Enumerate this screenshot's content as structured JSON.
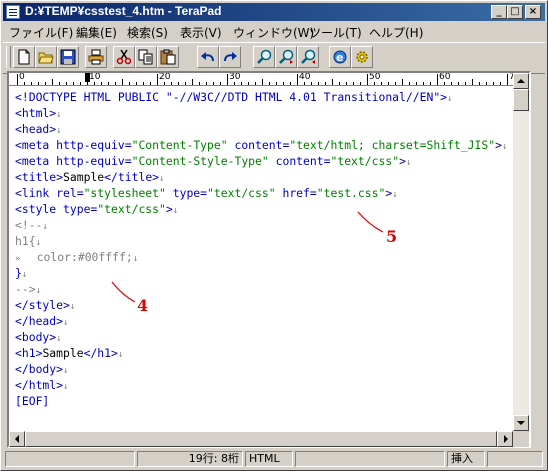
{
  "window": {
    "title": "D:¥TEMP¥csstest_4.htm - TeraPad",
    "controls": {
      "minimize": "_",
      "maximize": "□",
      "close": "×"
    }
  },
  "menu": {
    "items": [
      "ファイル(F)",
      "編集(E)",
      "検索(S)",
      "表示(V)",
      "ウィンドウ(W)",
      "ツール(T)",
      "ヘルプ(H)"
    ]
  },
  "toolbar": {
    "buttons": [
      "new-file-icon",
      "open-folder-icon",
      "save-icon",
      "print-icon",
      "cut-icon",
      "copy-icon",
      "paste-icon",
      "undo-icon",
      "redo-icon",
      "find-icon",
      "find-next-icon",
      "find-prev-icon",
      "browser-icon",
      "settings-icon"
    ]
  },
  "ruler": {
    "labels": [
      "0",
      "10",
      "20",
      "30",
      "40",
      "50",
      "60",
      "70"
    ],
    "caret_column": 10
  },
  "editor": {
    "lines": [
      [
        [
          "<!DOCTYPE HTML PUBLIC \"-//W3C//DTD HTML 4.01 Transitional//EN\">",
          "tag"
        ],
        [
          "↓",
          "mark"
        ]
      ],
      [
        [
          "<html>",
          "tag"
        ],
        [
          "↓",
          "mark"
        ]
      ],
      [
        [
          "<head>",
          "tag"
        ],
        [
          "↓",
          "mark"
        ]
      ],
      [
        [
          "<meta http-equiv=",
          "tag"
        ],
        [
          "\"Content-Type\"",
          "str"
        ],
        [
          " content=",
          "tag"
        ],
        [
          "\"text/html; charset=Shift_JIS\"",
          "str"
        ],
        [
          ">",
          "tag"
        ],
        [
          "↓",
          "mark"
        ]
      ],
      [
        [
          "<meta http-equiv=",
          "tag"
        ],
        [
          "\"Content-Style-Type\"",
          "str"
        ],
        [
          " content=",
          "tag"
        ],
        [
          "\"text/css\"",
          "str"
        ],
        [
          ">",
          "tag"
        ],
        [
          "↓",
          "mark"
        ]
      ],
      [
        [
          "<title>",
          "tag"
        ],
        [
          "Sample",
          "text"
        ],
        [
          "</title>",
          "tag"
        ],
        [
          "↓",
          "mark"
        ]
      ],
      [
        [
          "<link rel=",
          "tag"
        ],
        [
          "\"stylesheet\"",
          "str"
        ],
        [
          " type=",
          "tag"
        ],
        [
          "\"text/css\"",
          "str"
        ],
        [
          " href=",
          "tag"
        ],
        [
          "\"test.css\"",
          "str"
        ],
        [
          ">",
          "tag"
        ],
        [
          "↓",
          "mark"
        ]
      ],
      [
        [
          "<style type=",
          "tag"
        ],
        [
          "\"text/css\"",
          "str"
        ],
        [
          ">",
          "tag"
        ],
        [
          "↓",
          "mark"
        ]
      ],
      [
        [
          "<!--",
          "css"
        ],
        [
          "↓",
          "mark"
        ]
      ],
      [
        [
          "h1{",
          "css"
        ],
        [
          "↓",
          "mark"
        ]
      ],
      [
        [
          "»   ",
          "mark"
        ],
        [
          "color:#00ffff;",
          "css"
        ],
        [
          "↓",
          "mark"
        ]
      ],
      [
        [
          "}",
          "tag"
        ],
        [
          "↓",
          "mark"
        ]
      ],
      [
        [
          "-->",
          "css"
        ],
        [
          "↓",
          "mark"
        ]
      ],
      [
        [
          "</style>",
          "tag"
        ],
        [
          "↓",
          "mark"
        ]
      ],
      [
        [
          "</head>",
          "tag"
        ],
        [
          "↓",
          "mark"
        ]
      ],
      [
        [
          "<body>",
          "tag"
        ],
        [
          "↓",
          "mark"
        ]
      ],
      [
        [
          "<h1>",
          "tag"
        ],
        [
          "Sample",
          "text"
        ],
        [
          "</h1>",
          "tag"
        ],
        [
          "↓",
          "mark"
        ]
      ],
      [
        [
          "</body>",
          "tag"
        ],
        [
          "↓",
          "mark"
        ]
      ],
      [
        [
          "</html>",
          "tag"
        ],
        [
          "↓",
          "mark"
        ]
      ],
      [
        [
          "[EOF]",
          "tag"
        ]
      ]
    ]
  },
  "annotations": [
    {
      "label": "5"
    },
    {
      "label": "4"
    }
  ],
  "status": {
    "position": "19行:     8桁",
    "mode": "HTML",
    "insert": "挿入"
  },
  "colors": {
    "tag": "#0000c0",
    "string": "#008000",
    "comment": "#808080",
    "annotation": "#e00000"
  }
}
